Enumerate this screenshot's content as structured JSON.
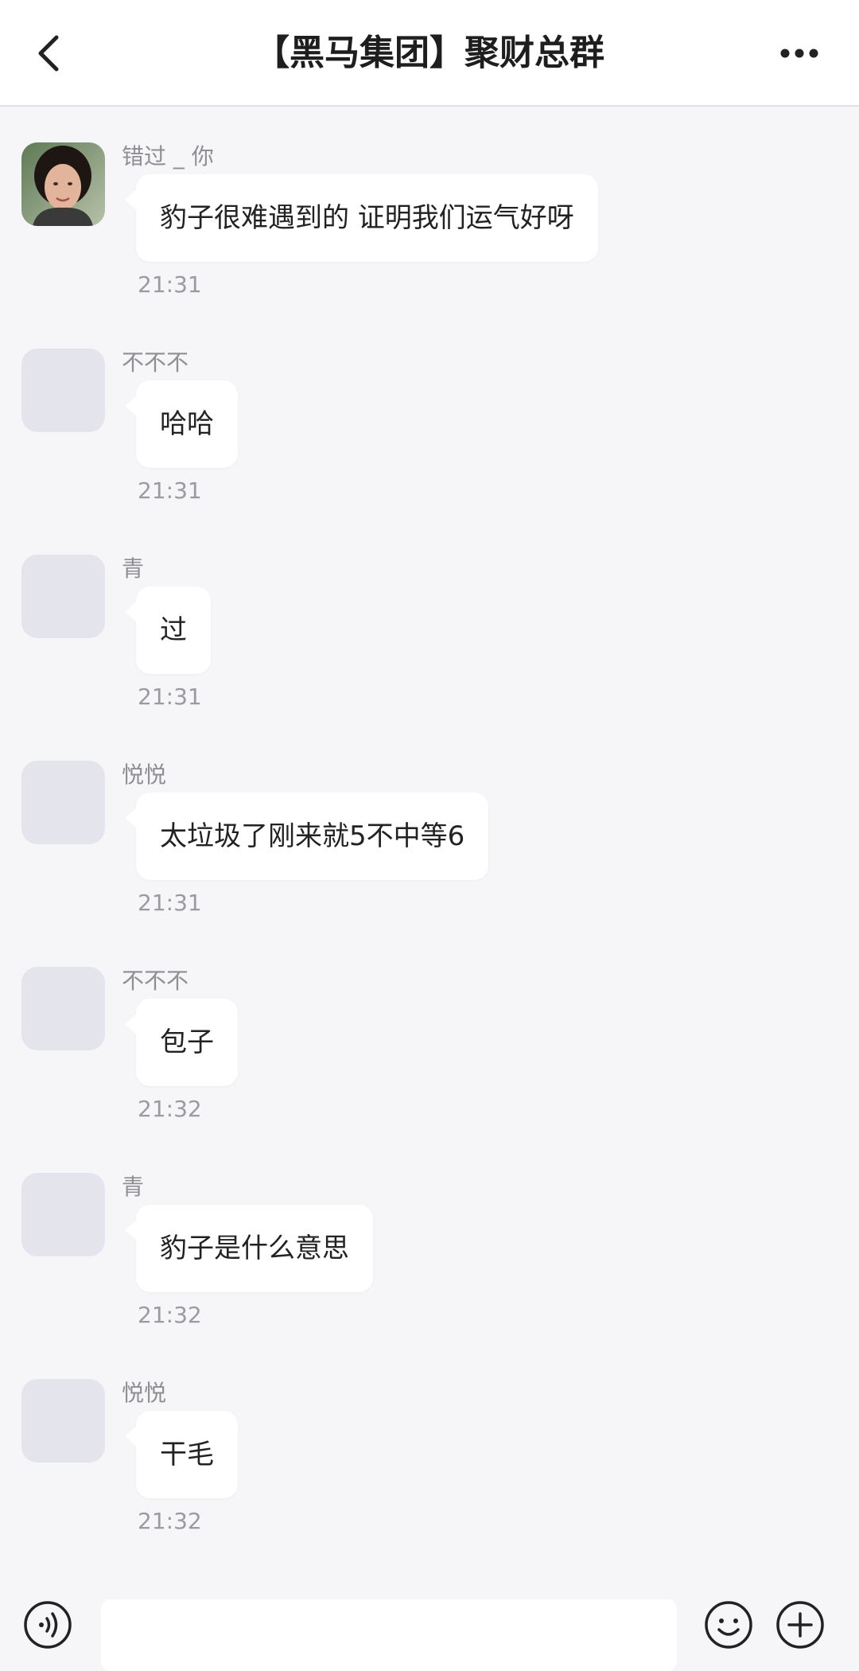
{
  "header": {
    "title": "【黑马集团】聚财总群",
    "back_icon": "chevron-left-icon",
    "more_icon": "more-horizontal-icon"
  },
  "messages": [
    {
      "sender": "错过 _ 你",
      "text": "豹子很难遇到的 证明我们运气好呀",
      "time": "21:31",
      "avatar": "photo"
    },
    {
      "sender": "不不不",
      "text": "哈哈",
      "time": "21:31",
      "avatar": "placeholder"
    },
    {
      "sender": "青",
      "text": "过",
      "time": "21:31",
      "avatar": "placeholder"
    },
    {
      "sender": "悦悦",
      "text": "太垃圾了刚来就5不中等6",
      "time": "21:31",
      "avatar": "placeholder"
    },
    {
      "sender": "不不不",
      "text": "包子",
      "time": "21:32",
      "avatar": "placeholder"
    },
    {
      "sender": "青",
      "text": "豹子是什么意思",
      "time": "21:32",
      "avatar": "placeholder"
    },
    {
      "sender": "悦悦",
      "text": "干毛",
      "time": "21:32",
      "avatar": "placeholder"
    }
  ],
  "input_bar": {
    "voice_icon": "voice-icon",
    "emoji_icon": "emoji-icon",
    "plus_icon": "plus-icon",
    "input_value": ""
  },
  "colors": {
    "background": "#f6f6f8",
    "bubble": "#ffffff",
    "avatar_placeholder": "#e4e4ec",
    "timestamp": "#9a9aa0"
  }
}
